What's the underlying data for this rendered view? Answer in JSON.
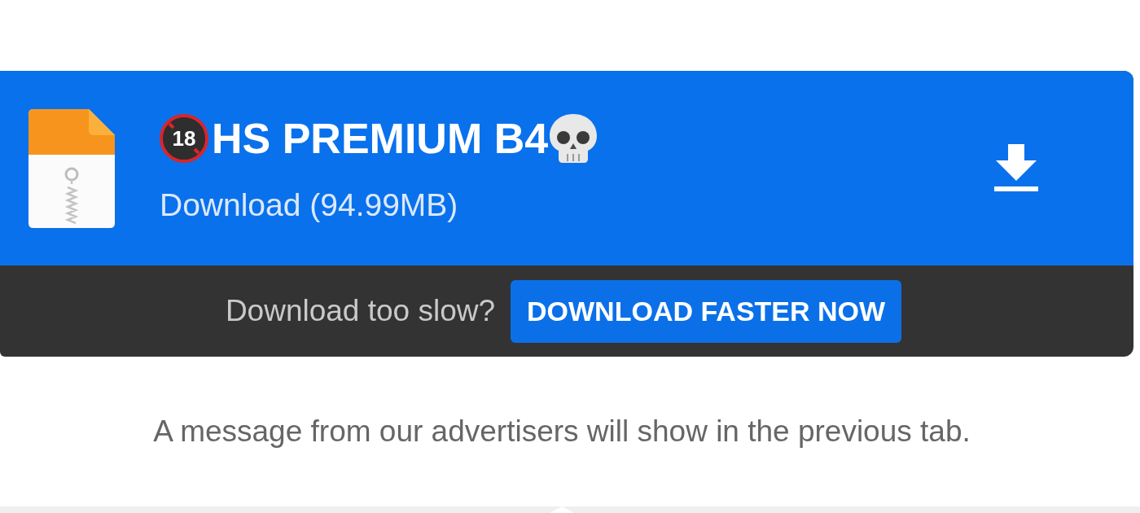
{
  "file": {
    "age_badge": "18",
    "name": "HS PREMIUM B4",
    "subtitle": "Download (94.99MB)"
  },
  "slow_bar": {
    "prompt": "Download too slow?",
    "button": "DOWNLOAD FASTER NOW"
  },
  "notice": "A message from our advertisers will show in the previous tab."
}
